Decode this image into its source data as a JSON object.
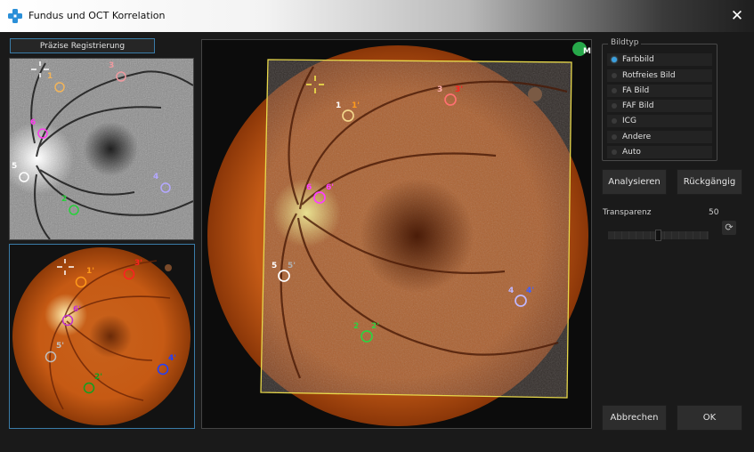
{
  "window": {
    "title": "Fundus  und OCT Korrelation"
  },
  "left": {
    "register_button": "Präzise Registrierung"
  },
  "right": {
    "group_title": "Bildtyp",
    "image_types": [
      {
        "label": "Farbbild",
        "selected": true
      },
      {
        "label": "Rotfreies Bild",
        "selected": false
      },
      {
        "label": "FA Bild",
        "selected": false
      },
      {
        "label": "FAF Bild",
        "selected": false
      },
      {
        "label": "ICG",
        "selected": false
      },
      {
        "label": "Andere",
        "selected": false
      },
      {
        "label": "Auto",
        "selected": false
      }
    ],
    "analyze_button": "Analysieren",
    "undo_button": "Rückgängig",
    "transparency_label": "Transparenz",
    "transparency_value": "50",
    "transparency_fraction": 0.5,
    "cancel_button": "Abbrechen",
    "ok_button": "OK"
  },
  "markers_oct": [
    {
      "label": "1",
      "color": "#f2b45a"
    },
    {
      "label": "3",
      "color": "#f09aa0"
    },
    {
      "label": "6",
      "color": "#ff3cf0"
    },
    {
      "label": "5",
      "color": "#ffffff"
    },
    {
      "label": "4",
      "color": "#b4a8ff"
    },
    {
      "label": "2",
      "color": "#27d03a"
    }
  ],
  "markers_fundus": [
    {
      "label": "1'",
      "color": "#ff9a1a"
    },
    {
      "label": "3'",
      "color": "#ff2020"
    },
    {
      "label": "6'",
      "color": "#c030d0"
    },
    {
      "label": "5'",
      "color": "#c0c0c0"
    },
    {
      "label": "4'",
      "color": "#2040ff"
    },
    {
      "label": "2'",
      "color": "#10a020"
    }
  ],
  "main_markers": [
    {
      "label": "1",
      "color": "#ffffff"
    },
    {
      "label": "1'",
      "color": "#ff9a1a"
    },
    {
      "label": "3",
      "color": "#ffb0b0"
    },
    {
      "label": "3'",
      "color": "#ff2020"
    },
    {
      "label": "6",
      "color": "#ff40ff"
    },
    {
      "label": "6'",
      "color": "#ff40ff"
    },
    {
      "label": "5",
      "color": "#ffffff"
    },
    {
      "label": "5'",
      "color": "#b0b0b0"
    },
    {
      "label": "4",
      "color": "#c0b8ff"
    },
    {
      "label": "4'",
      "color": "#4060ff"
    },
    {
      "label": "2",
      "color": "#30d040"
    },
    {
      "label": "2'",
      "color": "#30d040"
    }
  ],
  "colors": {
    "accent": "#3a7ca8",
    "overlay_border": "#e8d84a",
    "logo_green": "#27a84a"
  },
  "icons": {
    "app": "cross-logo-icon",
    "close": "close-icon",
    "reset": "refresh-icon",
    "logo": "cm-logo-icon"
  }
}
